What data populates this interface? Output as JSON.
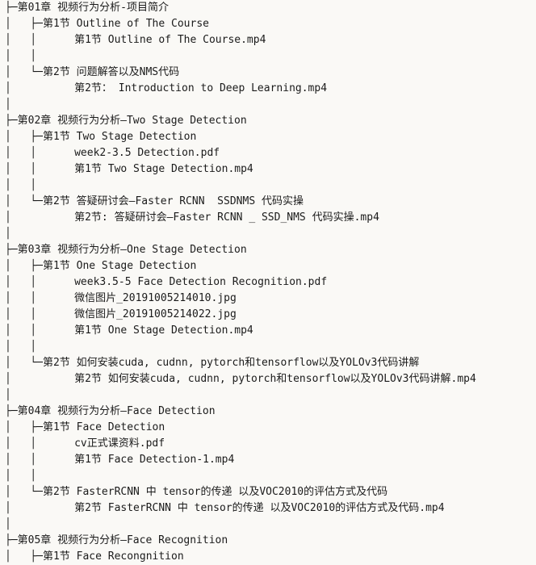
{
  "window": {
    "background_color": "#faf9f6",
    "text_color": "#1b1b1b",
    "view_type": "directory-tree-listing"
  },
  "tree": {
    "glyphs": {
      "branch": "├─",
      "last_branch": "└─",
      "vertical": "│",
      "indent": "    "
    },
    "lines": [
      {
        "id": "l01",
        "depth": 0,
        "kind": "chapter",
        "prefix": "├─",
        "text": "第01章 视频行为分析-项目简介"
      },
      {
        "id": "l02",
        "depth": 1,
        "kind": "section",
        "prefix": "│   ├─",
        "text": "第1节 Outline of The Course"
      },
      {
        "id": "l03",
        "depth": 2,
        "kind": "file",
        "prefix": "│   │      ",
        "text": "第1节 Outline of The Course.mp4"
      },
      {
        "id": "l04",
        "depth": 2,
        "kind": "spacer",
        "prefix": "│   │",
        "text": ""
      },
      {
        "id": "l05",
        "depth": 1,
        "kind": "section",
        "prefix": "│   └─",
        "text": "第2节 问题解答以及NMS代码"
      },
      {
        "id": "l06",
        "depth": 2,
        "kind": "file",
        "prefix": "│          ",
        "text": "第2节： Introduction to Deep Learning.mp4"
      },
      {
        "id": "l07",
        "depth": 1,
        "kind": "spacer",
        "prefix": "│",
        "text": ""
      },
      {
        "id": "l08",
        "depth": 0,
        "kind": "chapter",
        "prefix": "├─",
        "text": "第02章 视频行为分析—Two Stage Detection"
      },
      {
        "id": "l09",
        "depth": 1,
        "kind": "section",
        "prefix": "│   ├─",
        "text": "第1节 Two Stage Detection"
      },
      {
        "id": "l10",
        "depth": 2,
        "kind": "file",
        "prefix": "│   │      ",
        "text": "week2-3.5 Detection.pdf"
      },
      {
        "id": "l11",
        "depth": 2,
        "kind": "file",
        "prefix": "│   │      ",
        "text": "第1节 Two Stage Detection.mp4"
      },
      {
        "id": "l12",
        "depth": 2,
        "kind": "spacer",
        "prefix": "│   │",
        "text": ""
      },
      {
        "id": "l13",
        "depth": 1,
        "kind": "section",
        "prefix": "│   └─",
        "text": "第2节 答疑研讨会—Faster RCNN  SSDNMS 代码实操"
      },
      {
        "id": "l14",
        "depth": 2,
        "kind": "file",
        "prefix": "│          ",
        "text": "第2节: 答疑研讨会—Faster RCNN _ SSD_NMS 代码实操.mp4"
      },
      {
        "id": "l15",
        "depth": 1,
        "kind": "spacer",
        "prefix": "│",
        "text": ""
      },
      {
        "id": "l16",
        "depth": 0,
        "kind": "chapter",
        "prefix": "├─",
        "text": "第03章 视频行为分析—One Stage Detection"
      },
      {
        "id": "l17",
        "depth": 1,
        "kind": "section",
        "prefix": "│   ├─",
        "text": "第1节 One Stage Detection"
      },
      {
        "id": "l18",
        "depth": 2,
        "kind": "file",
        "prefix": "│   │      ",
        "text": "week3.5-5 Face Detection Recognition.pdf"
      },
      {
        "id": "l19",
        "depth": 2,
        "kind": "file",
        "prefix": "│   │      ",
        "text": "微信图片_20191005214010.jpg"
      },
      {
        "id": "l20",
        "depth": 2,
        "kind": "file",
        "prefix": "│   │      ",
        "text": "微信图片_20191005214022.jpg"
      },
      {
        "id": "l21",
        "depth": 2,
        "kind": "file",
        "prefix": "│   │      ",
        "text": "第1节 One Stage Detection.mp4"
      },
      {
        "id": "l22",
        "depth": 2,
        "kind": "spacer",
        "prefix": "│   │",
        "text": ""
      },
      {
        "id": "l23",
        "depth": 1,
        "kind": "section",
        "prefix": "│   └─",
        "text": "第2节 如何安装cuda, cudnn, pytorch和tensorflow以及YOLOv3代码讲解"
      },
      {
        "id": "l24",
        "depth": 2,
        "kind": "file",
        "prefix": "│          ",
        "text": "第2节 如何安装cuda, cudnn, pytorch和tensorflow以及YOLOv3代码讲解.mp4"
      },
      {
        "id": "l25",
        "depth": 1,
        "kind": "spacer",
        "prefix": "│",
        "text": ""
      },
      {
        "id": "l26",
        "depth": 0,
        "kind": "chapter",
        "prefix": "├─",
        "text": "第04章 视频行为分析—Face Detection"
      },
      {
        "id": "l27",
        "depth": 1,
        "kind": "section",
        "prefix": "│   ├─",
        "text": "第1节 Face Detection"
      },
      {
        "id": "l28",
        "depth": 2,
        "kind": "file",
        "prefix": "│   │      ",
        "text": "cv正式课资料.pdf"
      },
      {
        "id": "l29",
        "depth": 2,
        "kind": "file",
        "prefix": "│   │      ",
        "text": "第1节 Face Detection-1.mp4"
      },
      {
        "id": "l30",
        "depth": 2,
        "kind": "spacer",
        "prefix": "│   │",
        "text": ""
      },
      {
        "id": "l31",
        "depth": 1,
        "kind": "section",
        "prefix": "│   └─",
        "text": "第2节 FasterRCNN 中 tensor的传递 以及VOC2010的评估方式及代码"
      },
      {
        "id": "l32",
        "depth": 2,
        "kind": "file",
        "prefix": "│          ",
        "text": "第2节 FasterRCNN 中 tensor的传递 以及VOC2010的评估方式及代码.mp4"
      },
      {
        "id": "l33",
        "depth": 1,
        "kind": "spacer",
        "prefix": "│",
        "text": ""
      },
      {
        "id": "l34",
        "depth": 0,
        "kind": "chapter",
        "prefix": "├─",
        "text": "第05章 视频行为分析—Face Recognition"
      },
      {
        "id": "l35",
        "depth": 1,
        "kind": "section",
        "prefix": "│   ├─",
        "text": "第1节 Face Recongnition"
      }
    ]
  }
}
